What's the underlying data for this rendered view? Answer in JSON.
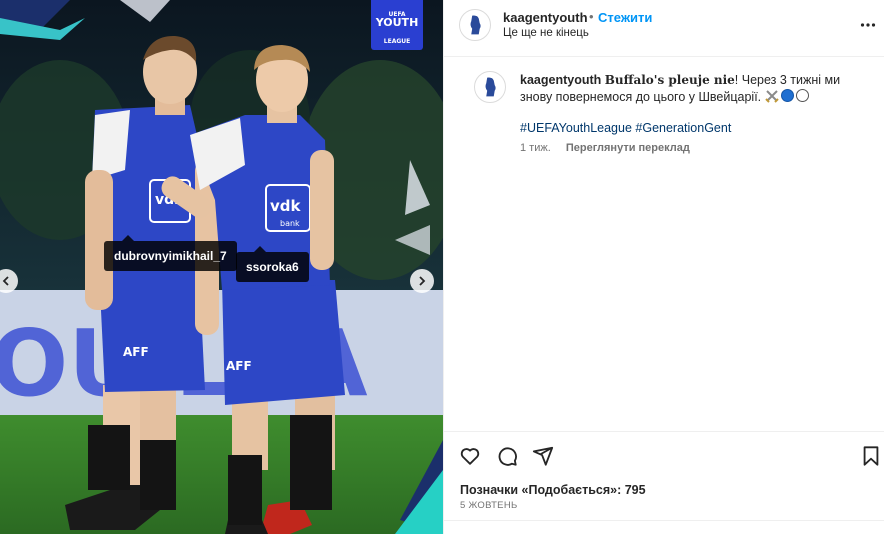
{
  "post": {
    "photo": {
      "badge": {
        "line1": "UEFA",
        "line2": "YOUTH",
        "line3": "LEAGUE"
      },
      "tags": [
        {
          "username": "dubrovnyimikhail_7"
        },
        {
          "username": "ssoroka6"
        }
      ],
      "jersey_sponsor": "vdk",
      "jersey_sponsor_sub": "bank",
      "shorts_logo": "AFF",
      "banner_text": "OU   LEA",
      "colors": {
        "kit_blue": "#2d47c6",
        "badge_blue": "#2a3fd1",
        "pitch": "#2f7d2a"
      }
    },
    "header": {
      "username": "kaagentyouth",
      "separator": "•",
      "follow_label": "Стежити",
      "subtitle": "Це ще не кінець",
      "more_icon": "more-horizontal-icon"
    },
    "caption": {
      "username": "kaagentyouth",
      "bold_text": "Buffalo's pleuje nie",
      "text_after_bold": "! Через 3 тижні ми знову повернемося до цього у Швейцарії.",
      "emoji": [
        "crossed-swords",
        "blue-circle",
        "white-circle"
      ],
      "hashtags": [
        "#UEFAYouthLeague",
        "#GenerationGent"
      ],
      "time_ago": "1 тиж.",
      "translate_label": "Переглянути переклад"
    },
    "actions": {
      "icons": [
        "heart-icon",
        "comment-icon",
        "share-icon",
        "bookmark-icon"
      ],
      "likes_text": "Позначки «Подобається»: 795",
      "date_text": "5 ЖОВТЕНЬ"
    },
    "colors": {
      "link_blue": "#0095f6",
      "hashtag_blue": "#00376b",
      "muted": "#737373"
    }
  }
}
